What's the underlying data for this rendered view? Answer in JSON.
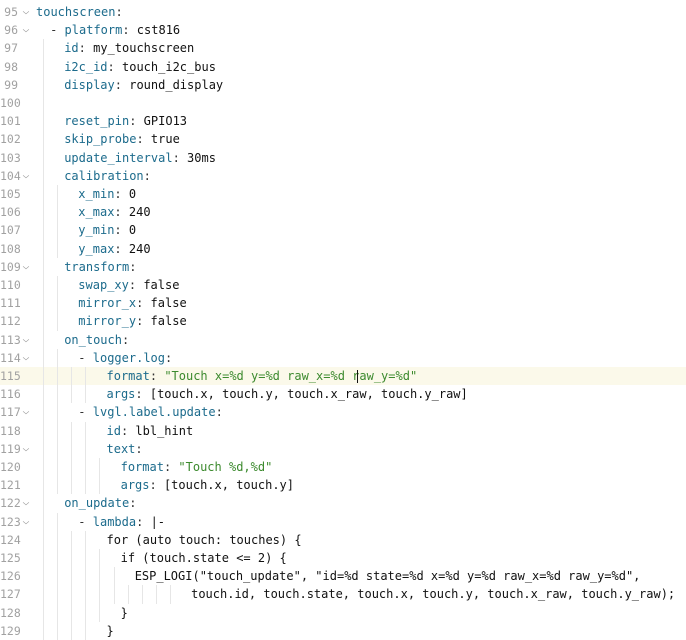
{
  "editor": {
    "current_line_index": 20,
    "lines": [
      {
        "n": "95",
        "fold": true,
        "indent": 0,
        "segs": [
          [
            "k",
            "touchscreen"
          ],
          [
            "p",
            ":"
          ]
        ]
      },
      {
        "n": "96",
        "fold": true,
        "indent": 1,
        "segs": [
          [
            "p",
            "- "
          ],
          [
            "k",
            "platform"
          ],
          [
            "p",
            ": "
          ],
          [
            "v",
            "cst816"
          ]
        ]
      },
      {
        "n": "97",
        "fold": false,
        "indent": 2,
        "segs": [
          [
            "k",
            "id"
          ],
          [
            "p",
            ": "
          ],
          [
            "v",
            "my_touchscreen"
          ]
        ]
      },
      {
        "n": "98",
        "fold": false,
        "indent": 2,
        "segs": [
          [
            "k",
            "i2c_id"
          ],
          [
            "p",
            ": "
          ],
          [
            "v",
            "touch_i2c_bus"
          ]
        ]
      },
      {
        "n": "99",
        "fold": false,
        "indent": 2,
        "segs": [
          [
            "k",
            "display"
          ],
          [
            "p",
            ": "
          ],
          [
            "v",
            "round_display"
          ]
        ]
      },
      {
        "n": "100",
        "fold": false,
        "indent": 2,
        "segs": []
      },
      {
        "n": "101",
        "fold": false,
        "indent": 2,
        "segs": [
          [
            "k",
            "reset_pin"
          ],
          [
            "p",
            ": "
          ],
          [
            "v",
            "GPIO13"
          ]
        ]
      },
      {
        "n": "102",
        "fold": false,
        "indent": 2,
        "segs": [
          [
            "k",
            "skip_probe"
          ],
          [
            "p",
            ": "
          ],
          [
            "v",
            "true"
          ]
        ]
      },
      {
        "n": "103",
        "fold": false,
        "indent": 2,
        "segs": [
          [
            "k",
            "update_interval"
          ],
          [
            "p",
            ": "
          ],
          [
            "v",
            "30ms"
          ]
        ]
      },
      {
        "n": "104",
        "fold": true,
        "indent": 2,
        "segs": [
          [
            "k",
            "calibration"
          ],
          [
            "p",
            ":"
          ]
        ]
      },
      {
        "n": "105",
        "fold": false,
        "indent": 3,
        "segs": [
          [
            "k",
            "x_min"
          ],
          [
            "p",
            ": "
          ],
          [
            "v",
            "0"
          ]
        ]
      },
      {
        "n": "106",
        "fold": false,
        "indent": 3,
        "segs": [
          [
            "k",
            "x_max"
          ],
          [
            "p",
            ": "
          ],
          [
            "v",
            "240"
          ]
        ]
      },
      {
        "n": "107",
        "fold": false,
        "indent": 3,
        "segs": [
          [
            "k",
            "y_min"
          ],
          [
            "p",
            ": "
          ],
          [
            "v",
            "0"
          ]
        ]
      },
      {
        "n": "108",
        "fold": false,
        "indent": 3,
        "segs": [
          [
            "k",
            "y_max"
          ],
          [
            "p",
            ": "
          ],
          [
            "v",
            "240"
          ]
        ]
      },
      {
        "n": "109",
        "fold": true,
        "indent": 2,
        "segs": [
          [
            "k",
            "transform"
          ],
          [
            "p",
            ":"
          ]
        ]
      },
      {
        "n": "110",
        "fold": false,
        "indent": 3,
        "segs": [
          [
            "k",
            "swap_xy"
          ],
          [
            "p",
            ": "
          ],
          [
            "v",
            "false"
          ]
        ]
      },
      {
        "n": "111",
        "fold": false,
        "indent": 3,
        "segs": [
          [
            "k",
            "mirror_x"
          ],
          [
            "p",
            ": "
          ],
          [
            "v",
            "false"
          ]
        ]
      },
      {
        "n": "112",
        "fold": false,
        "indent": 3,
        "segs": [
          [
            "k",
            "mirror_y"
          ],
          [
            "p",
            ": "
          ],
          [
            "v",
            "false"
          ]
        ]
      },
      {
        "n": "113",
        "fold": true,
        "indent": 2,
        "segs": [
          [
            "k",
            "on_touch"
          ],
          [
            "p",
            ":"
          ]
        ]
      },
      {
        "n": "114",
        "fold": true,
        "indent": 3,
        "segs": [
          [
            "p",
            "- "
          ],
          [
            "k",
            "logger.log"
          ],
          [
            "p",
            ":"
          ]
        ]
      },
      {
        "n": "115",
        "fold": false,
        "indent": 5,
        "segs": [
          [
            "k",
            "format"
          ],
          [
            "p",
            ": "
          ],
          [
            "s",
            "\"Touch x=%d y=%d raw_x=%d raw_y=%d\""
          ]
        ]
      },
      {
        "n": "116",
        "fold": false,
        "indent": 5,
        "segs": [
          [
            "k",
            "args"
          ],
          [
            "p",
            ": "
          ],
          [
            "v",
            "[touch.x, touch.y, touch.x_raw, touch.y_raw]"
          ]
        ]
      },
      {
        "n": "117",
        "fold": true,
        "indent": 3,
        "segs": [
          [
            "p",
            "- "
          ],
          [
            "k",
            "lvgl.label.update"
          ],
          [
            "p",
            ":"
          ]
        ]
      },
      {
        "n": "118",
        "fold": false,
        "indent": 5,
        "segs": [
          [
            "k",
            "id"
          ],
          [
            "p",
            ": "
          ],
          [
            "v",
            "lbl_hint"
          ]
        ]
      },
      {
        "n": "119",
        "fold": true,
        "indent": 5,
        "segs": [
          [
            "k",
            "text"
          ],
          [
            "p",
            ":"
          ]
        ]
      },
      {
        "n": "120",
        "fold": false,
        "indent": 6,
        "segs": [
          [
            "k",
            "format"
          ],
          [
            "p",
            ": "
          ],
          [
            "s",
            "\"Touch %d,%d\""
          ]
        ]
      },
      {
        "n": "121",
        "fold": false,
        "indent": 6,
        "segs": [
          [
            "k",
            "args"
          ],
          [
            "p",
            ": "
          ],
          [
            "v",
            "[touch.x, touch.y]"
          ]
        ]
      },
      {
        "n": "122",
        "fold": true,
        "indent": 2,
        "segs": [
          [
            "k",
            "on_update"
          ],
          [
            "p",
            ":"
          ]
        ]
      },
      {
        "n": "123",
        "fold": true,
        "indent": 3,
        "segs": [
          [
            "p",
            "- "
          ],
          [
            "k",
            "lambda"
          ],
          [
            "p",
            ": "
          ],
          [
            "v",
            "|-"
          ]
        ]
      },
      {
        "n": "124",
        "fold": false,
        "indent": 5,
        "segs": [
          [
            "v",
            "for (auto touch: touches) {"
          ]
        ]
      },
      {
        "n": "125",
        "fold": false,
        "indent": 6,
        "segs": [
          [
            "v",
            "if (touch.state <= 2) {"
          ]
        ]
      },
      {
        "n": "126",
        "fold": false,
        "indent": 7,
        "segs": [
          [
            "v",
            "ESP_LOGI(\"touch_update\", \"id=%d state=%d x=%d y=%d raw_x=%d raw_y=%d\","
          ]
        ]
      },
      {
        "n": "127",
        "fold": false,
        "indent": 11,
        "segs": [
          [
            "v",
            "touch.id, touch.state, touch.x, touch.y, touch.x_raw, touch.y_raw);"
          ]
        ]
      },
      {
        "n": "128",
        "fold": false,
        "indent": 6,
        "segs": [
          [
            "v",
            "}"
          ]
        ]
      },
      {
        "n": "129",
        "fold": false,
        "indent": 5,
        "segs": [
          [
            "v",
            "}"
          ]
        ]
      }
    ]
  },
  "icons": {
    "fold": "chevron-down-icon"
  },
  "colors": {
    "key": "#1c6b8c",
    "string": "#3c8a2e",
    "gutter": "#a1a1a1",
    "current_line": "#fbf9ea"
  }
}
